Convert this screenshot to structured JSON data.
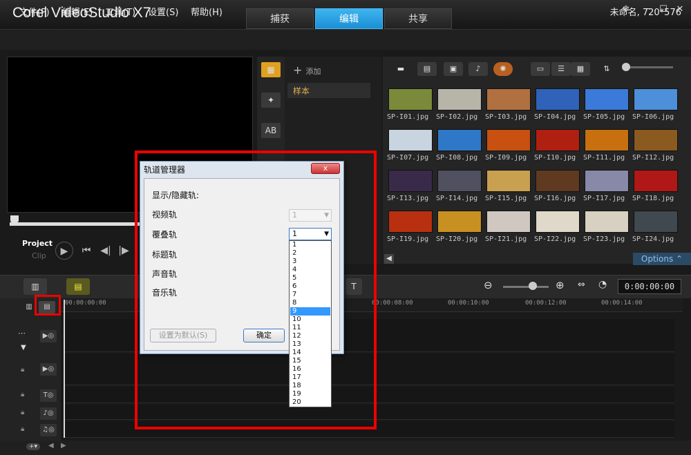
{
  "app": {
    "title": "Corel VideoStudio X7"
  },
  "tabs": [
    {
      "label": "捕获"
    },
    {
      "label": "编辑"
    },
    {
      "label": "共享"
    }
  ],
  "menu": [
    {
      "label": "文件(F)"
    },
    {
      "label": "编辑(E)"
    },
    {
      "label": "工具(T)"
    },
    {
      "label": "设置(S)"
    },
    {
      "label": "帮助(H)"
    }
  ],
  "project_info": "未命名, 720*576",
  "player": {
    "project": "Project",
    "clip": "Clip"
  },
  "library": {
    "add": "添加",
    "folder": "样本"
  },
  "thumbnails": [
    "SP-I01.jpg",
    "SP-I02.jpg",
    "SP-I03.jpg",
    "SP-I04.jpg",
    "SP-I05.jpg",
    "SP-I06.jpg",
    "SP-I07.jpg",
    "SP-I08.jpg",
    "SP-I09.jpg",
    "SP-I10.jpg",
    "SP-I11.jpg",
    "SP-I12.jpg",
    "SP-I13.jpg",
    "SP-I14.jpg",
    "SP-I15.jpg",
    "SP-I16.jpg",
    "SP-I17.jpg",
    "SP-I18.jpg",
    "SP-I19.jpg",
    "SP-I20.jpg",
    "SP-I21.jpg",
    "SP-I22.jpg",
    "SP-I23.jpg",
    "SP-I24.jpg"
  ],
  "thumb_colors": [
    "#7a8a3a",
    "#b7b4a8",
    "#b07040",
    "#2f62b8",
    "#3b7ad8",
    "#4d8fd8",
    "#c8d4e0",
    "#2f78c8",
    "#c85010",
    "#b02010",
    "#c87010",
    "#8a5a20",
    "#3a2a4a",
    "#505060",
    "#c8a050",
    "#603a20",
    "#8888a8",
    "#b01818",
    "#b83010",
    "#c89020",
    "#d0c8c0",
    "#e0d8c8",
    "#d8d0c0",
    "#404850"
  ],
  "options_label": "Options",
  "timecode": "0:00:00:00",
  "ruler": [
    "00:00:00:00",
    "00:00:08:00",
    "00:00:10:00",
    "00:00:12:00",
    "00:00:14:00"
  ],
  "dialog": {
    "title": "轨道管理器",
    "close": "x",
    "heading": "显示/隐藏轨:",
    "rows": [
      {
        "label": "视频轨"
      },
      {
        "label": "覆叠轨"
      },
      {
        "label": "标题轨"
      },
      {
        "label": "声音轨"
      },
      {
        "label": "音乐轨"
      }
    ],
    "video_value": "1",
    "overlay_value": "1",
    "options": [
      "1",
      "2",
      "3",
      "4",
      "5",
      "6",
      "7",
      "8",
      "9",
      "10",
      "11",
      "12",
      "13",
      "14",
      "15",
      "16",
      "17",
      "18",
      "19",
      "20"
    ],
    "selected_option": "9",
    "default_button": "设置为默认(S)",
    "ok_button": "确定"
  }
}
